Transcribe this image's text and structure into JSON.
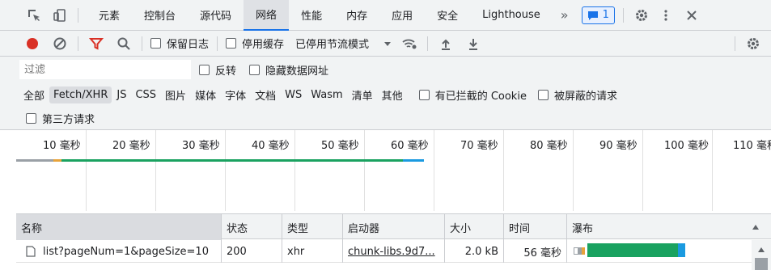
{
  "tabs": [
    {
      "label": "元素"
    },
    {
      "label": "控制台"
    },
    {
      "label": "源代码"
    },
    {
      "label": "网络"
    },
    {
      "label": "性能"
    },
    {
      "label": "内存"
    },
    {
      "label": "应用"
    },
    {
      "label": "安全"
    },
    {
      "label": "Lighthouse"
    }
  ],
  "more_tabs": "»",
  "issues_count": "1",
  "toolbar": {
    "preserve_log": "保留日志",
    "disable_cache": "停用缓存",
    "throttle": "已停用节流模式"
  },
  "filter": {
    "placeholder": "过滤",
    "invert": "反转",
    "hide_data_urls": "隐藏数据网址"
  },
  "types": [
    {
      "label": "全部"
    },
    {
      "label": "Fetch/XHR"
    },
    {
      "label": "JS"
    },
    {
      "label": "CSS"
    },
    {
      "label": "图片"
    },
    {
      "label": "媒体"
    },
    {
      "label": "字体"
    },
    {
      "label": "文档"
    },
    {
      "label": "WS"
    },
    {
      "label": "Wasm"
    },
    {
      "label": "清单"
    },
    {
      "label": "其他"
    }
  ],
  "blocked_cookies": "有已拦截的 Cookie",
  "blocked_requests": "被屏蔽的请求",
  "third_party": "第三方请求",
  "overview_ticks": [
    "10 毫秒",
    "20 毫秒",
    "30 毫秒",
    "40 毫秒",
    "50 毫秒",
    "60 毫秒",
    "70 毫秒",
    "80 毫秒",
    "90 毫秒",
    "100 毫秒",
    "110 毫秒"
  ],
  "columns": {
    "name": "名称",
    "status": "状态",
    "type": "类型",
    "initiator": "启动器",
    "size": "大小",
    "time": "时间",
    "waterfall": "瀑布"
  },
  "requests": [
    {
      "name": "list?pageNum=1&pageSize=10",
      "status": "200",
      "type": "xhr",
      "initiator": "chunk-libs.9d7...",
      "size": "2.0 kB",
      "time": "56 毫秒"
    }
  ],
  "colors": {
    "accent": "#1a73e8",
    "record": "#d93025",
    "filter_icon": "#d93025",
    "waterfall_green": "#1aa260",
    "waterfall_blue": "#1a9ae0"
  }
}
